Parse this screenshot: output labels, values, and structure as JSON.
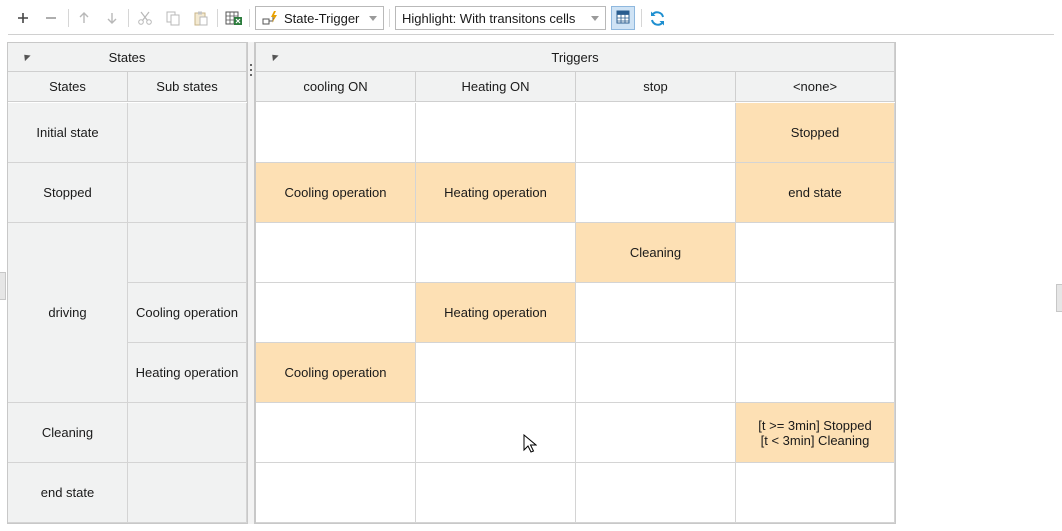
{
  "toolbar": {
    "view_mode": "State-Trigger",
    "highlight_mode": "Highlight: With transitons cells",
    "icons": [
      "add-icon",
      "remove-icon",
      "move-up-icon",
      "move-down-icon",
      "cut-icon",
      "copy-icon",
      "paste-icon",
      "export-icon",
      "table-view-icon",
      "refresh-icon"
    ]
  },
  "states_panel": {
    "group_header": "States",
    "col_states": "States",
    "col_substates": "Sub states"
  },
  "triggers_panel": {
    "group_header": "Triggers",
    "columns": [
      "cooling ON",
      "Heating ON",
      "stop",
      "<none>"
    ]
  },
  "rows": [
    {
      "state": "Initial state",
      "substate": "",
      "cells": [
        "",
        "",
        "",
        "Stopped"
      ]
    },
    {
      "state": "Stopped",
      "substate": "",
      "cells": [
        "Cooling operation",
        "Heating operation",
        "",
        "end state"
      ]
    },
    {
      "state": "driving",
      "substate": "",
      "cells": [
        "",
        "",
        "Cleaning",
        ""
      ]
    },
    {
      "state": "",
      "substate": "Cooling operation",
      "cells": [
        "",
        "Heating operation",
        "",
        ""
      ]
    },
    {
      "state": "",
      "substate": "Heating operation",
      "cells": [
        "Cooling operation",
        "",
        "",
        ""
      ]
    },
    {
      "state": "Cleaning",
      "substate": "",
      "cells": [
        "",
        "",
        "",
        "[t >= 3min] Stopped\n[t < 3min] Cleaning"
      ]
    },
    {
      "state": "end state",
      "substate": "",
      "cells": [
        "",
        "",
        "",
        ""
      ]
    }
  ],
  "colors": {
    "highlight": "#fde0b4",
    "header_bg": "#f1f2f2",
    "accent": "#2b8fd6"
  }
}
